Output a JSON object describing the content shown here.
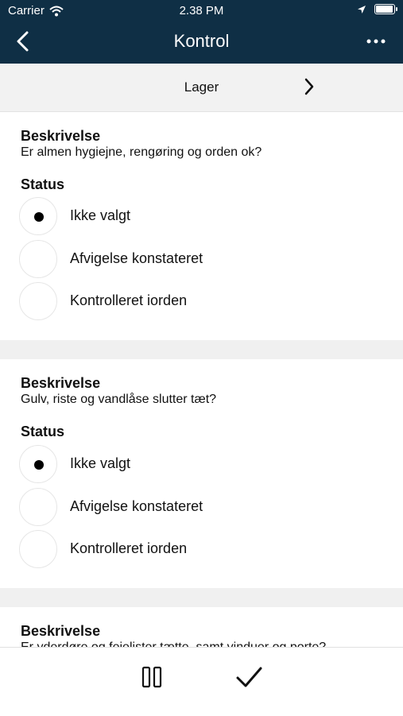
{
  "status_bar": {
    "carrier": "Carrier",
    "time": "2.38 PM"
  },
  "nav": {
    "title": "Kontrol",
    "back_icon": "chevron-left-icon",
    "more_icon": "more-horizontal-icon"
  },
  "location": {
    "label": "Lager",
    "next_icon": "chevron-right-icon"
  },
  "items": [
    {
      "description_heading": "Beskrivelse",
      "description": "Er almen hygiejne, rengøring og orden ok?",
      "status_heading": "Status",
      "options": [
        "Ikke valgt",
        "Afvigelse konstateret",
        "Kontrolleret iorden"
      ],
      "selected": "Ikke valgt"
    },
    {
      "description_heading": "Beskrivelse",
      "description": "Gulv, riste og vandlåse slutter tæt?",
      "status_heading": "Status",
      "options": [
        "Ikke valgt",
        "Afvigelse konstateret",
        "Kontrolleret iorden"
      ],
      "selected": "Ikke valgt"
    },
    {
      "description_heading": "Beskrivelse",
      "description": "Er yderdøre og fejelister tætte, samt vinduer og porte?"
    }
  ],
  "toolbar": {
    "pause_icon": "pause-icon",
    "done_icon": "checkmark-icon"
  },
  "colors": {
    "header": "#0f2f45",
    "location_bar": "#f2f2f2",
    "separator": "#f0f0f0"
  }
}
